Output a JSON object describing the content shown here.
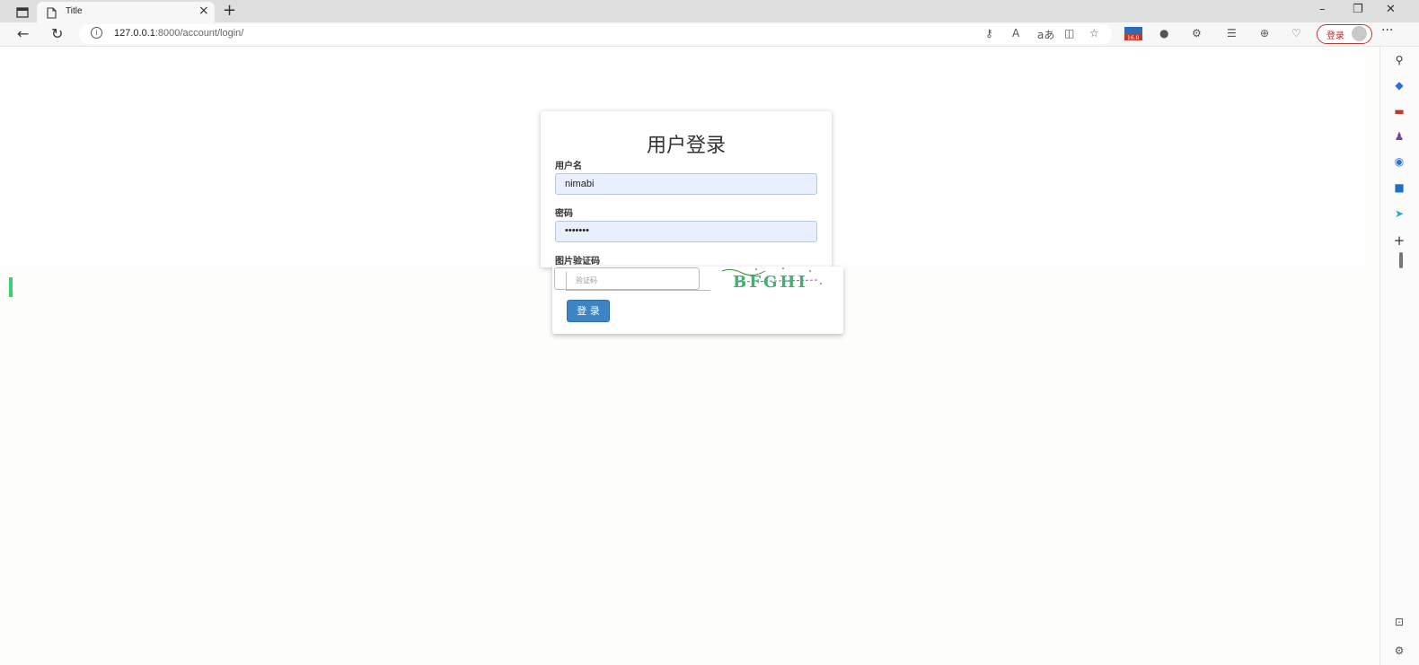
{
  "browser": {
    "tab_title": "Title",
    "url_host": "127.0.0.1",
    "url_rest": ":8000/account/login/",
    "profile_button": "登录",
    "badge_value": "16.0"
  },
  "login": {
    "heading": "用户登录",
    "username_label": "用户名",
    "username_value": "nimabi",
    "password_label": "密码",
    "password_value": "•••••••",
    "captcha_label": "图片验证码",
    "captcha_placeholder": "验证码",
    "captcha_text": "BFGHI",
    "submit_label": "登 录"
  },
  "colors": {
    "primary": "#3c84c4",
    "autofill": "#e8f0fe",
    "profile_border": "#c0392b"
  }
}
